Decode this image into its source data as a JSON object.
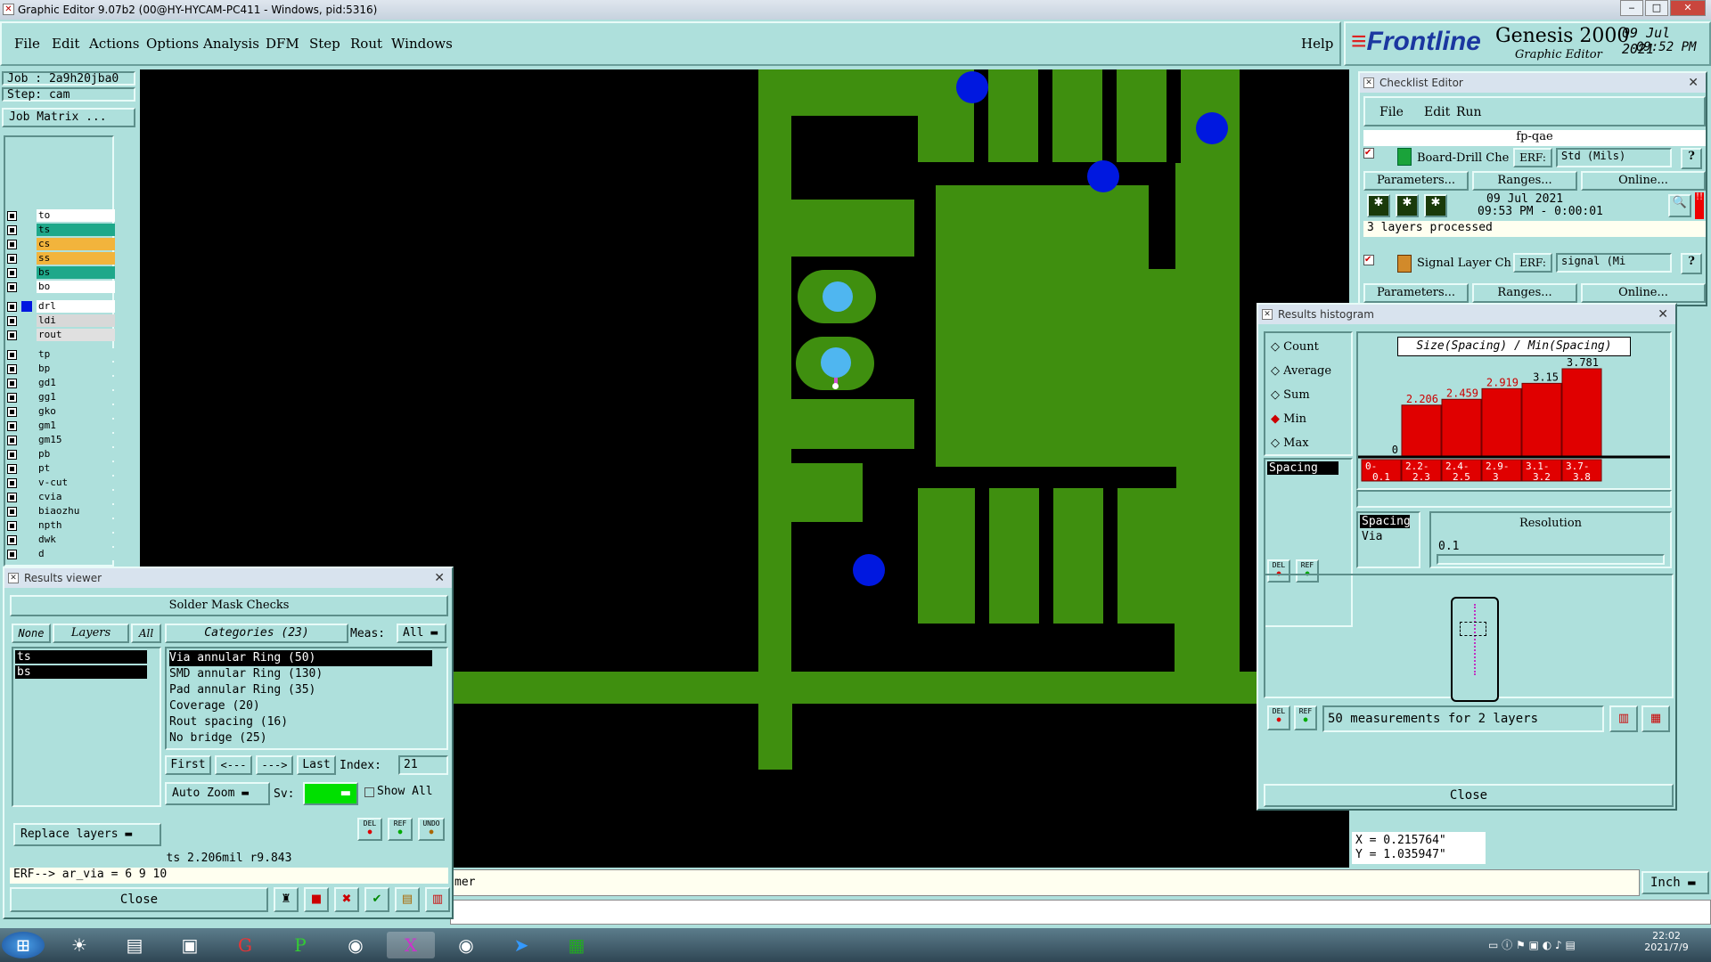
{
  "window_title": "Graphic Editor 9.07b2 (00@HY-HYCAM-PC411 - Windows, pid:5316)",
  "menu": [
    "File",
    "Edit",
    "Actions",
    "Options",
    "Analysis",
    "DFM",
    "Step",
    "Rout",
    "Windows"
  ],
  "help": "Help",
  "logo": {
    "brand": "Frontline",
    "product": "Genesis 2000",
    "subtitle": "Graphic Editor",
    "date": "09 Jul 2021",
    "time": "09:52 PM"
  },
  "job": {
    "job_label": "Job : 2a9h20jba0",
    "step_label": "Step: cam",
    "matrix_button": "Job Matrix ..."
  },
  "layers": [
    {
      "name": "to",
      "color": "#ffffff"
    },
    {
      "name": "ts",
      "color": "#1ea88a"
    },
    {
      "name": "cs",
      "color": "#f2b43c"
    },
    {
      "name": "ss",
      "color": "#f2b43c"
    },
    {
      "name": "bs",
      "color": "#1ea88a"
    },
    {
      "name": "bo",
      "color": "#ffffff"
    },
    {
      "name": "drl",
      "color": "#ffffff"
    },
    {
      "name": "ldi",
      "color": "#d8d8d8"
    },
    {
      "name": "rout",
      "color": "#e0e0e0"
    },
    {
      "name": "tp",
      "color": "#aee0dc"
    },
    {
      "name": "bp",
      "color": "#aee0dc"
    },
    {
      "name": "gd1",
      "color": "#aee0dc"
    },
    {
      "name": "gg1",
      "color": "#aee0dc"
    },
    {
      "name": "gko",
      "color": "#aee0dc"
    },
    {
      "name": "gm1",
      "color": "#aee0dc"
    },
    {
      "name": "gm15",
      "color": "#aee0dc"
    },
    {
      "name": "pb",
      "color": "#aee0dc"
    },
    {
      "name": "pt",
      "color": "#aee0dc"
    },
    {
      "name": "v-cut",
      "color": "#aee0dc"
    },
    {
      "name": "cvia",
      "color": "#aee0dc"
    },
    {
      "name": "biaozhu",
      "color": "#aee0dc"
    },
    {
      "name": "npth",
      "color": "#aee0dc"
    },
    {
      "name": "dwk",
      "color": "#aee0dc"
    },
    {
      "name": "d",
      "color": "#aee0dc"
    }
  ],
  "results_viewer": {
    "title": "Results viewer",
    "header": "Solder Mask Checks",
    "none": "None",
    "layers": "Layers",
    "all": "All",
    "categories": "Categories (23)",
    "meas_label": "Meas:",
    "meas_value": "All",
    "layer_list": [
      "ts",
      "bs"
    ],
    "category_list": [
      "Via annular Ring (50)",
      "SMD annular Ring (130)",
      "Pad annular Ring (35)",
      "Coverage (20)",
      "Rout spacing (16)",
      "No bridge (25)"
    ],
    "first": "First",
    "prev": "<---",
    "next": "--->",
    "last": "Last",
    "index_label": "Index:",
    "index_value": "21",
    "auto_zoom": "Auto Zoom",
    "sv_label": "Sv:",
    "show_all": "Show All",
    "replace_layers": "Replace layers",
    "status": "ts 2.206mil  r9.843",
    "erf": "ERF--> ar_via = 6 9 10",
    "close": "Close",
    "del": "DEL",
    "ref": "REF",
    "undo": "UNDO"
  },
  "checklist": {
    "title": "Checklist Editor",
    "menu": [
      "File",
      "Edit",
      "Run"
    ],
    "name": "fp-qae",
    "check1": {
      "name": "Board-Drill Che",
      "erf_label": "ERF:",
      "erf_value": "Std (Mils)",
      "date": "09 Jul 2021",
      "time": "09:53 PM - 0:00:01",
      "status": "3 layers processed"
    },
    "check2": {
      "name": "Signal Layer Ch",
      "erf_label": "ERF:",
      "erf_value": "signal (Mi"
    },
    "parameters": "Parameters...",
    "ranges": "Ranges...",
    "online": "Online...",
    "help": "?"
  },
  "histogram": {
    "title": "Results histogram",
    "options": [
      "Count",
      "Average",
      "Sum",
      "Min",
      "Max"
    ],
    "selected_option": "Min",
    "heading": "Size(Spacing) / Min(Spacing)",
    "left_list": [
      "Spacing"
    ],
    "right_list": [
      "Spacing",
      "Via"
    ],
    "resolution_label": "Resolution",
    "resolution_value": "0.1",
    "summary": "50 measurements for 2 layers",
    "close": "Close",
    "del": "DEL",
    "ref": "REF"
  },
  "chart_data": {
    "type": "bar",
    "title": "Size(Spacing) / Min(Spacing)",
    "categories": [
      "0-0.1",
      "2.2-2.3",
      "2.4-2.5",
      "2.9-3",
      "3.1-3.2",
      "3.7-3.8"
    ],
    "values": [
      0,
      2.206,
      2.459,
      2.919,
      3.15,
      3.781
    ],
    "labels": [
      "0",
      "2.206",
      "2.459",
      "2.919",
      "3.15",
      "3.781"
    ],
    "ylim": [
      0,
      3.781
    ]
  },
  "coords": {
    "x": "X = 0.215764\"",
    "y": "Y = 1.035947\""
  },
  "units": "Inch",
  "cmd_fragment": "mer",
  "clock": {
    "time": "22:02",
    "date": "2021/7/9"
  }
}
